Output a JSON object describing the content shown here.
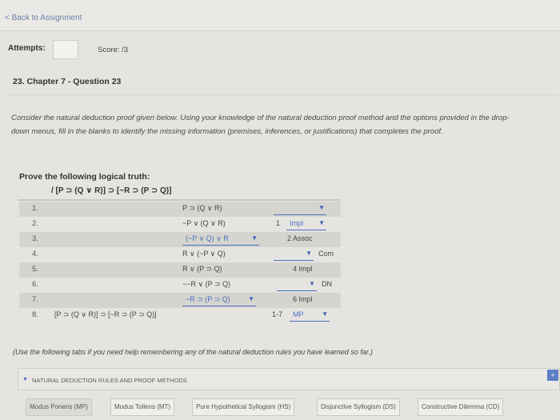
{
  "header": {
    "back_link": "< Back to Assignment"
  },
  "attempts": {
    "label": "Attempts:",
    "score_label": "Score:  /3"
  },
  "question": {
    "title": "23. Chapter 7 - Question 23"
  },
  "instructions": {
    "line1": "Consider the natural deduction proof given below. Using your knowledge of the natural deduction proof method and the options provided in the drop-",
    "line2": "down menus, fill in the blanks to identify the missing information (premises, inferences, or justifications) that completes the proof."
  },
  "proof": {
    "prove_label": "Prove the following logical truth:",
    "formula": "/ [P ⊃ (Q ∨ R)] ⊃ [~R ⊃ (P ⊃ Q)]",
    "rows": [
      {
        "n": "1.",
        "stmt": "P ⊃ (Q ∨ R)",
        "just_num": "",
        "just_dd": ""
      },
      {
        "n": "2.",
        "stmt": "~P ∨ (Q ∨ R)",
        "just_num": "1",
        "just_dd": "Impl"
      },
      {
        "n": "3.",
        "stmt": "(~P ∨ Q) ∨ R",
        "just": "2 Assoc"
      },
      {
        "n": "4.",
        "stmt": "R ∨ (~P ∨ Q)",
        "just_dd_suffix": "Com"
      },
      {
        "n": "5.",
        "stmt": "R ∨ (P ⊃ Q)",
        "just": "4 Impl"
      },
      {
        "n": "6.",
        "stmt": "~~R ∨ (P ⊃ Q)",
        "just_dd_suffix": "DN"
      },
      {
        "n": "7.",
        "stmt": "~R ⊃ (P ⊃ Q)",
        "just": "6 Impl"
      },
      {
        "n": "8.",
        "stmt": "[P ⊃ (Q ∨ R)] ⊃ [~R ⊃ (P ⊃ Q)]",
        "just_num": "1-7",
        "just_dd": "MP"
      }
    ]
  },
  "help": {
    "note": "(Use the following tabs if you need help remembering any of the natural deduction rules you have learned so far.)",
    "accordion_label": "NATURAL DEDUCTION RULES AND PROOF METHODS",
    "plus": "+",
    "tabs": [
      "Modus Ponens (MP)",
      "Modus Tollens (MT)",
      "Pure Hypothetical Syllogism (HS)",
      "Disjunctive Syllogism (DS)",
      "Constructive Dilemma (CD)"
    ]
  },
  "colors": {
    "accent": "#4a6ec2",
    "row_shade": "#d6d4cf"
  }
}
